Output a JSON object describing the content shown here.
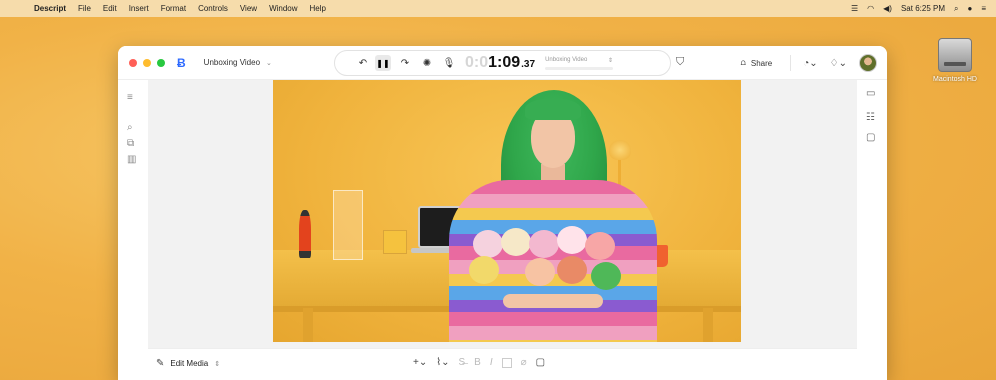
{
  "menubar": {
    "app_name": "Descript",
    "items": [
      "File",
      "Edit",
      "Insert",
      "Format",
      "Controls",
      "View",
      "Window",
      "Help"
    ],
    "clock": "Sat 6:25 PM"
  },
  "desktop": {
    "drive_label": "Macintosh HD"
  },
  "titlebar": {
    "project_name": "Unboxing Video",
    "share_label": "Share"
  },
  "transport": {
    "timecode_ghost": "0:0",
    "timecode_main": "1:09",
    "timecode_fraction": ".37",
    "scene_label": "Unboxing Video"
  },
  "bottom": {
    "edit_media_label": "Edit Media"
  },
  "colors": {
    "accent": "#2f6bff",
    "desktop_bg": "#f1b247",
    "close": "#ff5f57",
    "minimize": "#febc2e",
    "zoom": "#28c840"
  },
  "icons": {
    "menubar_left": "apple-icon",
    "transport": [
      "rewind-icon",
      "pause-icon",
      "forward-icon",
      "studio-sound-icon",
      "microphone-icon"
    ],
    "toolbar_right": [
      "present-icon",
      "share-icon",
      "publish-icon",
      "notification-icon"
    ],
    "left_sidebar": [
      "menu-icon",
      "search-icon",
      "copy-icon",
      "library-icon"
    ],
    "right_sidebar": [
      "properties-icon",
      "settings-icon",
      "comment-icon"
    ],
    "bottom_tools": [
      "add-icon",
      "brush-icon",
      "strikethrough-icon",
      "bold-icon",
      "italic-icon",
      "color-swatch-icon",
      "link-icon",
      "comment-icon"
    ]
  }
}
